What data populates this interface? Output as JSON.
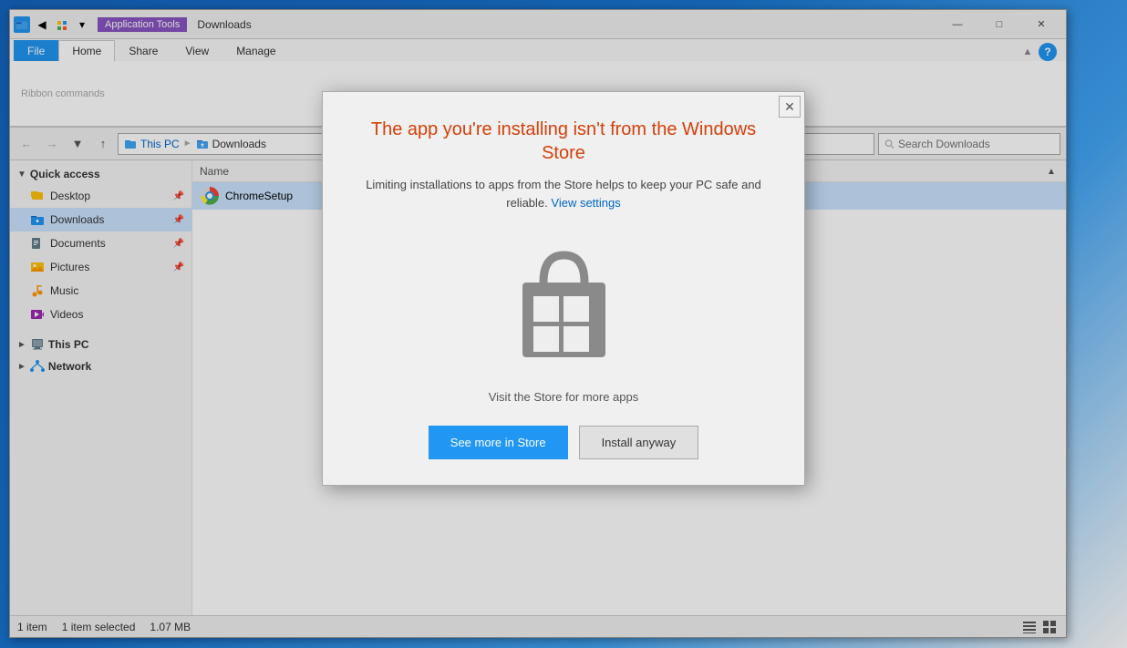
{
  "window": {
    "title": "Downloads",
    "ribbon_tab_label": "Application Tools"
  },
  "titlebar": {
    "app_icon": "folder-icon",
    "title": "Downloads",
    "ribbon_highlight": "Application Tools",
    "minimize": "—",
    "maximize": "□",
    "close": "✕"
  },
  "ribbon": {
    "tabs": [
      {
        "label": "File",
        "active": false,
        "file": true
      },
      {
        "label": "Home",
        "active": true
      },
      {
        "label": "Share",
        "active": false
      },
      {
        "label": "View",
        "active": false
      },
      {
        "label": "Manage",
        "active": false
      }
    ]
  },
  "addressbar": {
    "back": "←",
    "forward": "→",
    "up": "↑",
    "breadcrumb_home": "This PC",
    "breadcrumb_folder": "Downloads",
    "search_placeholder": "Search Downloads",
    "help_icon": "?"
  },
  "sidebar": {
    "quick_access_label": "Quick access",
    "items": [
      {
        "label": "Desktop",
        "icon": "folder-icon",
        "pinned": true
      },
      {
        "label": "Downloads",
        "icon": "download-folder-icon",
        "pinned": true,
        "selected": true
      },
      {
        "label": "Documents",
        "icon": "folder-icon",
        "pinned": true
      },
      {
        "label": "Pictures",
        "icon": "folder-icon",
        "pinned": true
      },
      {
        "label": "Music",
        "icon": "music-icon"
      },
      {
        "label": "Videos",
        "icon": "video-icon"
      }
    ],
    "this_pc_label": "This PC",
    "network_label": "Network"
  },
  "filelist": {
    "column_name": "Name",
    "files": [
      {
        "name": "ChromeSetup",
        "icon": "chrome-icon",
        "selected": true
      }
    ]
  },
  "statusbar": {
    "item_count": "1 item",
    "selection": "1 item selected",
    "size": "1.07 MB"
  },
  "modal": {
    "title": "The app you're installing isn't from the Windows Store",
    "subtitle": "Limiting installations to apps from the Store helps to keep your PC safe and reliable.",
    "link_text": "View settings",
    "store_visit_text": "Visit the Store for more apps",
    "close_btn": "✕",
    "btn_store": "See more in Store",
    "btn_install": "Install anyway"
  }
}
